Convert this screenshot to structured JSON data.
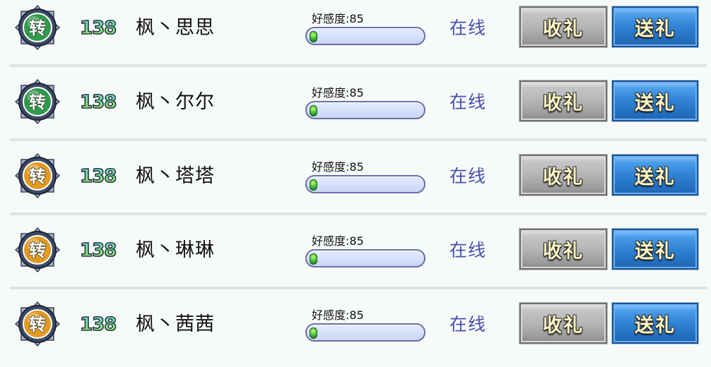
{
  "friends": [
    {
      "medal_glyph": "转",
      "medal_color": "#2f9b4a",
      "level": "138",
      "name": "枫丶思思",
      "affection_label": "好感度:85",
      "status": "在线",
      "receive_label": "收礼",
      "send_label": "送礼"
    },
    {
      "medal_glyph": "转",
      "medal_color": "#2f9b4a",
      "level": "138",
      "name": "枫丶尔尔",
      "affection_label": "好感度:85",
      "status": "在线",
      "receive_label": "收礼",
      "send_label": "送礼"
    },
    {
      "medal_glyph": "转",
      "medal_color": "#e39a1f",
      "level": "138",
      "name": "枫丶塔塔",
      "affection_label": "好感度:85",
      "status": "在线",
      "receive_label": "收礼",
      "send_label": "送礼"
    },
    {
      "medal_glyph": "转",
      "medal_color": "#e39a1f",
      "level": "138",
      "name": "枫丶琳琳",
      "affection_label": "好感度:85",
      "status": "在线",
      "receive_label": "收礼",
      "send_label": "送礼"
    },
    {
      "medal_glyph": "转",
      "medal_color": "#e39a1f",
      "level": "138",
      "name": "枫丶茜茜",
      "affection_label": "好感度:85",
      "status": "在线",
      "receive_label": "收礼",
      "send_label": "送礼"
    }
  ],
  "affection_fill_fraction": 0.06,
  "colors": {
    "status_text": "#4a4fae",
    "receive_button": "#b5b5b5",
    "send_button": "#2c7fd1",
    "button_text": "#fff6c4"
  }
}
